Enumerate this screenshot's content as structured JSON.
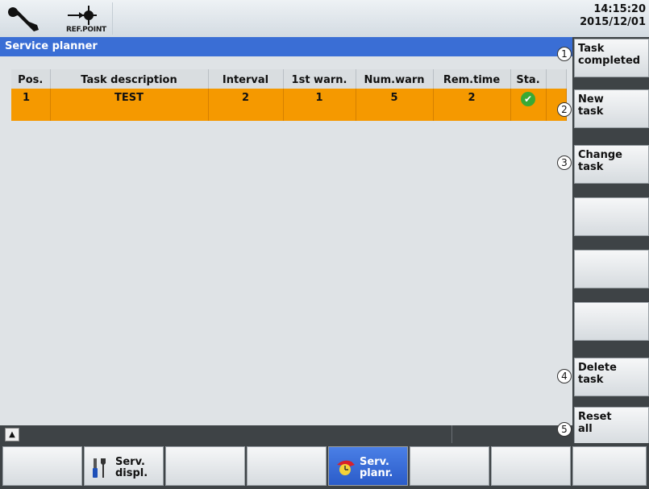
{
  "topbar": {
    "ref_point_label": "REF.POINT",
    "time": "14:15:20",
    "date": "2015/12/01",
    "icons": [
      "wrench-icon",
      "ref-point-icon"
    ]
  },
  "title": "Service planner",
  "table": {
    "headers": [
      "Pos.",
      "Task description",
      "Interval",
      "1st warn.",
      "Num.warn",
      "Rem.time",
      "Sta."
    ],
    "rows": [
      {
        "pos": "1",
        "description": "TEST",
        "interval": "2",
        "first_warn": "1",
        "num_warn": "5",
        "rem_time": "2",
        "status_icon": "check-ok-icon"
      }
    ],
    "row_color": "#f59900"
  },
  "softkeys_right": [
    {
      "label": "Task\ncompleted",
      "number": "1"
    },
    {
      "label": "New\ntask",
      "number": "2"
    },
    {
      "label": "Change\ntask",
      "number": "3"
    },
    {
      "label": "",
      "number": ""
    },
    {
      "label": "",
      "number": ""
    },
    {
      "label": "",
      "number": ""
    },
    {
      "label": "Delete\ntask",
      "number": "4"
    },
    {
      "label": "Reset\nall",
      "number": "5"
    }
  ],
  "softkeys_bottom": [
    {
      "label": ""
    },
    {
      "label": "Serv.\ndispl.",
      "icon": "tools-icon"
    },
    {
      "label": ""
    },
    {
      "label": ""
    },
    {
      "label": "Serv.\nplanr.",
      "icon": "service-planner-icon",
      "active": true
    },
    {
      "label": ""
    },
    {
      "label": ""
    },
    {
      "label": ""
    }
  ],
  "colors": {
    "title_bar": "#3a6ed5",
    "active_key": "#2b5cc9",
    "status_ok": "#39a935"
  }
}
